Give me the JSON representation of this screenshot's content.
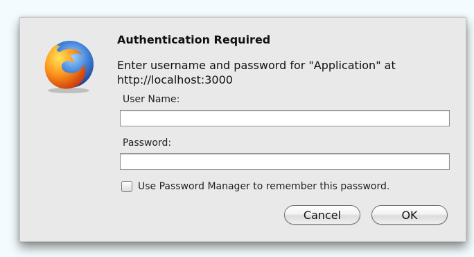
{
  "dialog": {
    "title": "Authentication Required",
    "message": "Enter username and password for \"Application\" at http://localhost:3000",
    "username_label": "User Name:",
    "username_value": "",
    "password_label": "Password:",
    "password_value": "",
    "remember_label": "Use Password Manager to remember this password.",
    "remember_checked": false,
    "cancel_label": "Cancel",
    "ok_label": "OK"
  },
  "icons": {
    "app_logo": "firefox-logo-icon"
  },
  "colors": {
    "dialog_bg": "#e9e9e9",
    "page_bg": "#f2fbfd"
  }
}
